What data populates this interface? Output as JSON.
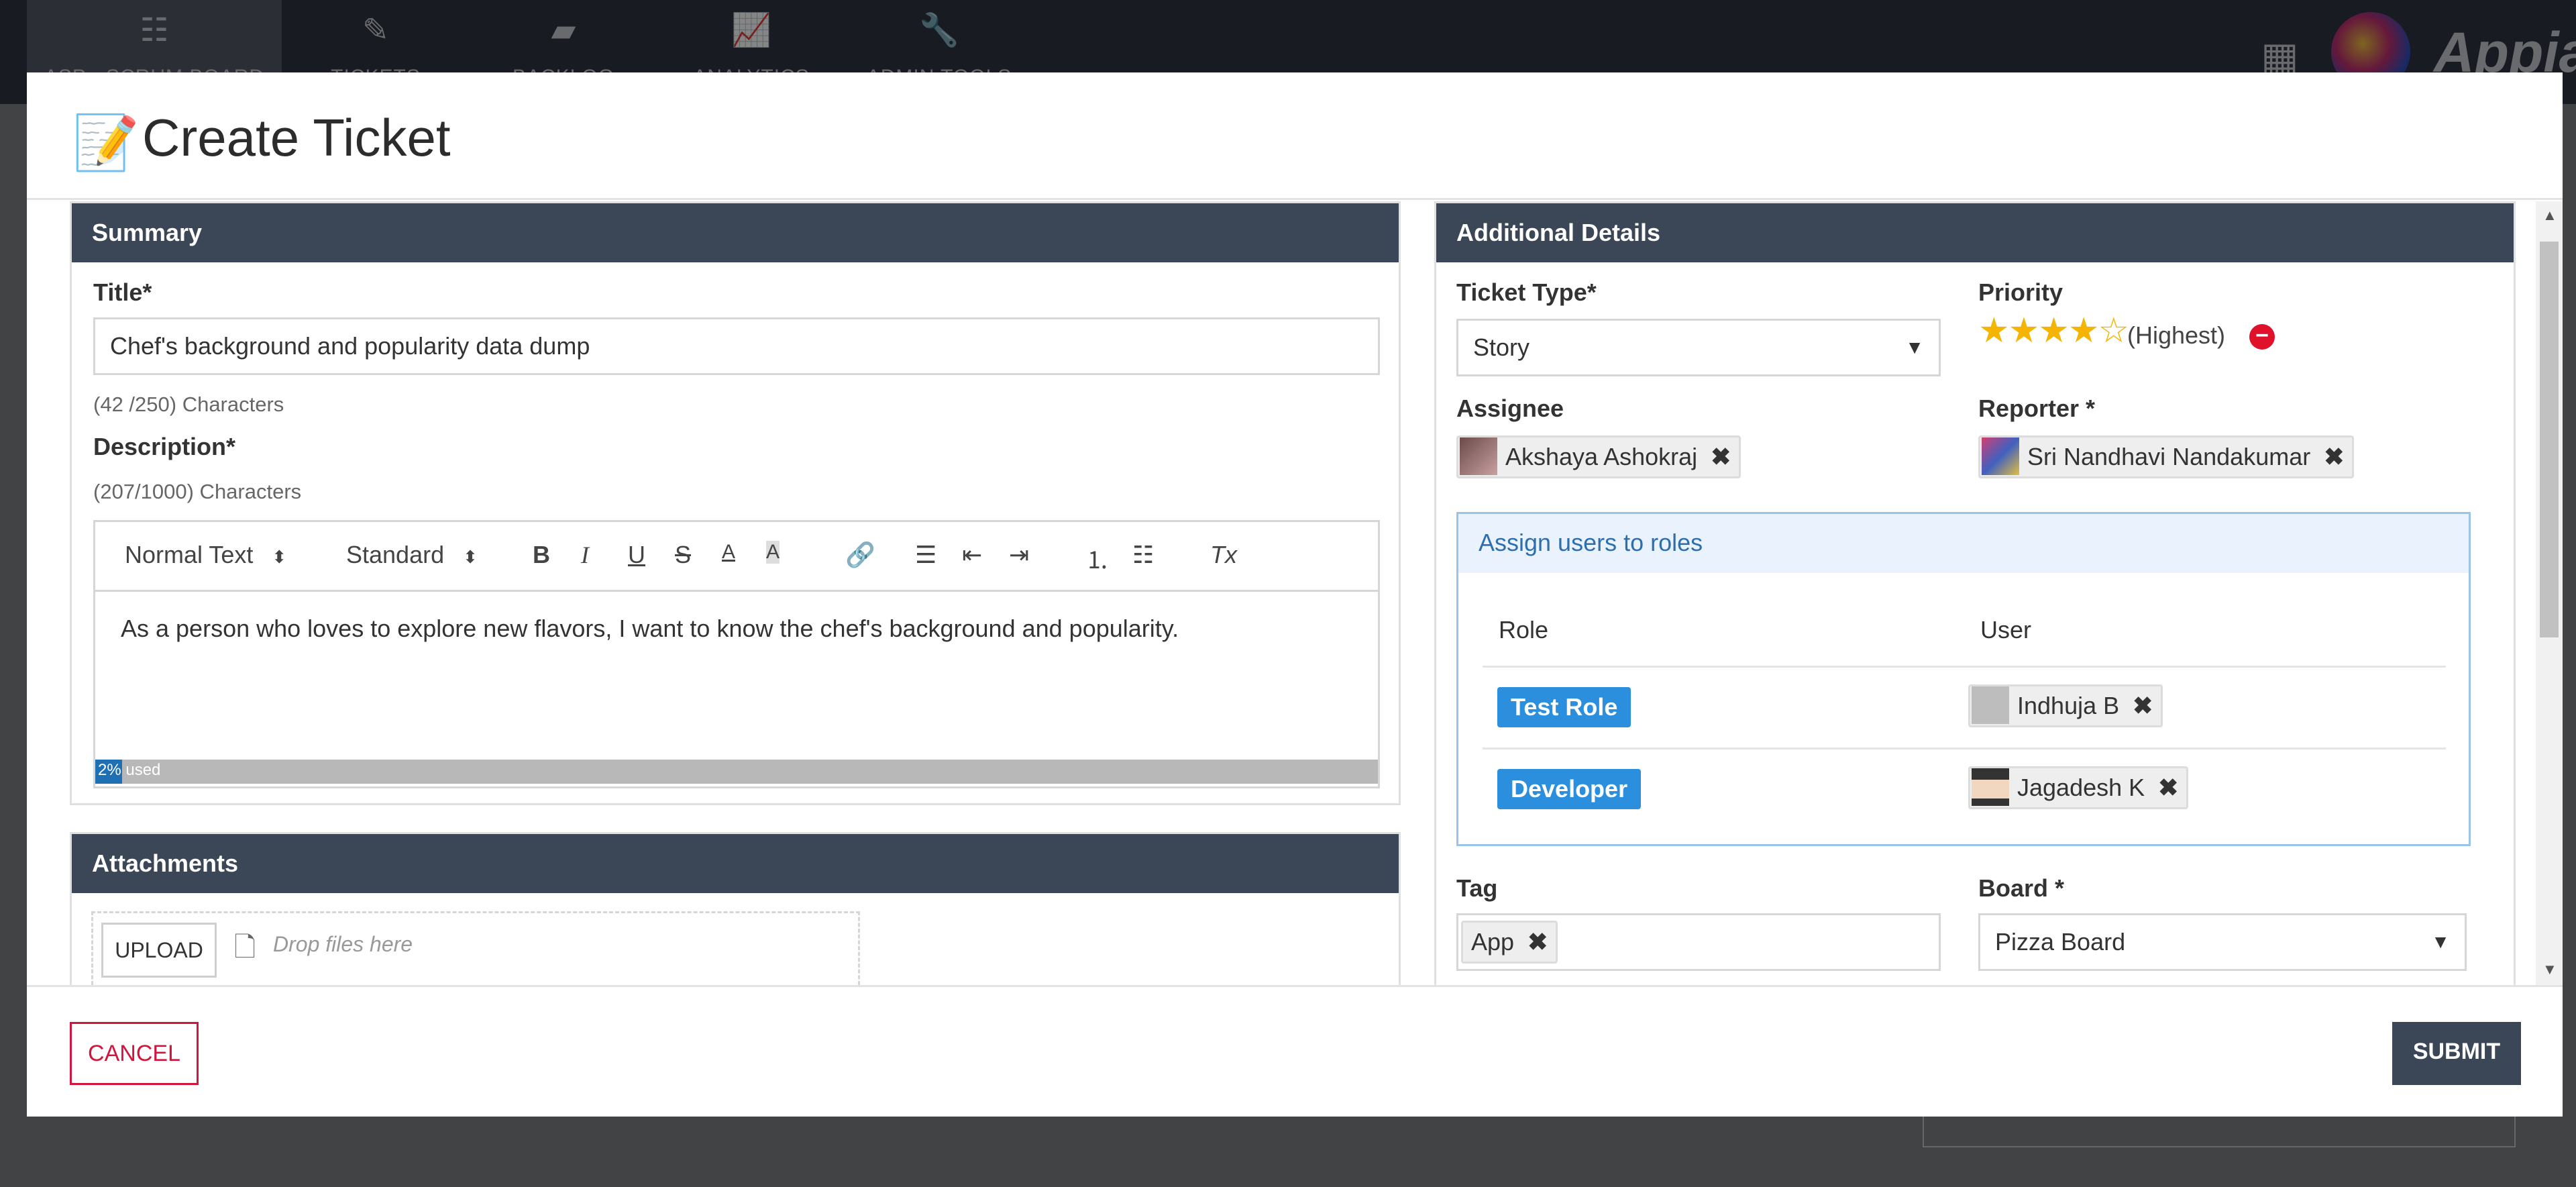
{
  "app": {
    "brand": "Appian",
    "nav": [
      {
        "label": "ASP - SCRUM BOARD",
        "icon": "grid-icon",
        "glyph": "☷"
      },
      {
        "label": "TICKETS",
        "icon": "ticket-icon",
        "glyph": "✎"
      },
      {
        "label": "BACKLOG",
        "icon": "backlog-icon",
        "glyph": "▰"
      },
      {
        "label": "ANALYTICS",
        "icon": "analytics-icon",
        "glyph": "📈"
      },
      {
        "label": "ADMIN TOOLS",
        "icon": "wrench-icon",
        "glyph": "🔧"
      }
    ]
  },
  "modal": {
    "title": "Create Ticket",
    "summary": {
      "header": "Summary",
      "title_label": "Title*",
      "title_value": "Chef's background and popularity data dump",
      "title_count": "(42 /250) Characters",
      "description_label": "Description*",
      "description_count": "(207/1000) Characters",
      "toolbar": {
        "text_style": "Normal Text",
        "size": "Standard",
        "bold": "B",
        "italic": "I",
        "underline": "U",
        "strike": "S",
        "color": "A",
        "highlight": "A",
        "clear": "Tx"
      },
      "description_text": "As a person who loves to explore new flavors, I want to know the chef's background and popularity.",
      "usage_percent": "2%",
      "usage_label": "used"
    },
    "attachments": {
      "header": "Attachments",
      "upload_label": "UPLOAD",
      "drop_text": "Drop files here"
    },
    "details": {
      "header": "Additional Details",
      "ticket_type_label": "Ticket Type*",
      "ticket_type_value": "Story",
      "priority_label": "Priority",
      "priority_stars_filled": 4,
      "priority_stars_total": 5,
      "priority_text": "(Highest)",
      "assignee_label": "Assignee",
      "assignee": "Akshaya Ashokraj",
      "reporter_label": "Reporter *",
      "reporter": "Sri Nandhavi Nandakumar",
      "roles": {
        "header": "Assign users to roles",
        "col_role": "Role",
        "col_user": "User",
        "rows": [
          {
            "role": "Test Role",
            "user": "Indhuja B"
          },
          {
            "role": "Developer",
            "user": "Jagadesh K"
          }
        ]
      },
      "tag_label": "Tag",
      "tag_value": "App",
      "board_label": "Board *",
      "board_value": "Pizza Board"
    },
    "footer": {
      "cancel": "CANCEL",
      "submit": "SUBMIT"
    }
  },
  "colors": {
    "header_dark": "#3b4657",
    "cancel_red": "#d1153c",
    "role_blue": "#2b8fde",
    "star_gold": "#f5b400"
  }
}
